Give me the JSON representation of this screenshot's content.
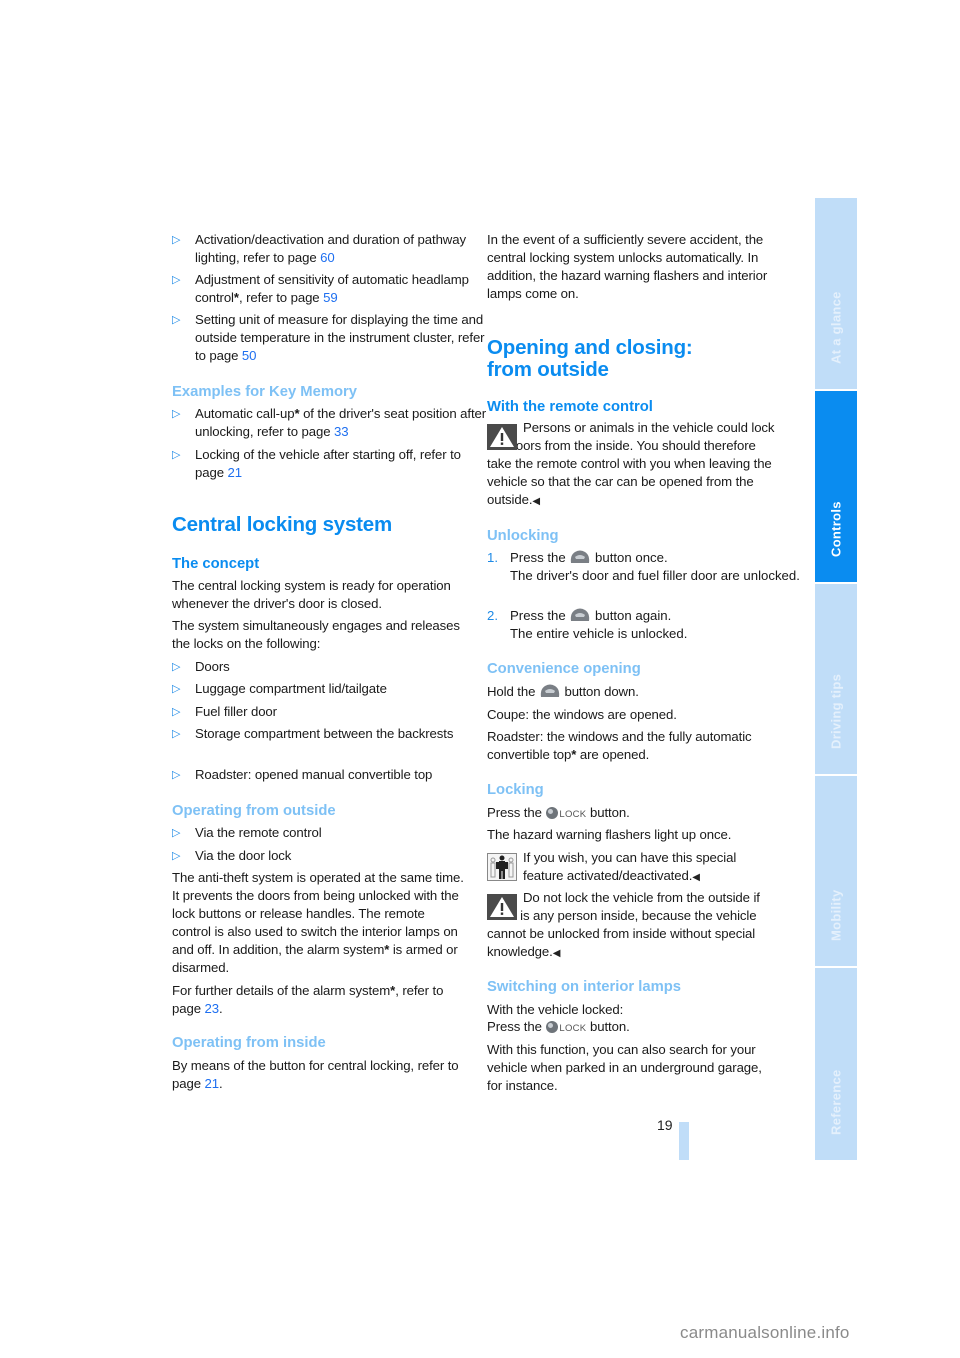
{
  "page_number": "19",
  "watermark": "carmanualsonline.info",
  "sidebar": {
    "tabs": [
      {
        "label": "At a glance",
        "active": false
      },
      {
        "label": "Controls",
        "active": true
      },
      {
        "label": "Driving tips",
        "active": false
      },
      {
        "label": "Mobility",
        "active": false
      },
      {
        "label": "Reference",
        "active": false
      }
    ]
  },
  "colors": {
    "heading": "#0a8cf0",
    "subheading_light": "#7ec1f5",
    "link": "#1e6ff0",
    "sidebar_active": "#0a8cf0",
    "sidebar_inactive": "#c0ddf8"
  },
  "left": {
    "top_bullets": [
      {
        "text": "Activation/deactivation and duration of pathway lighting, refer to page ",
        "page": "60"
      },
      {
        "text_a": "Adjustment of sensitivity of automatic headlamp control",
        "star": "*",
        "text_b": ", refer to page ",
        "page": "59"
      },
      {
        "text": "Setting unit of measure for displaying the time and outside temperature in the instrument cluster, refer to page ",
        "page": "50"
      }
    ],
    "key_memory": {
      "heading": "Examples for Key Memory",
      "bullets": [
        {
          "text_a": "Automatic call-up",
          "star": "*",
          "text_b": " of the driver's seat position after unlocking, refer to page ",
          "page": "33"
        },
        {
          "text": "Locking of the vehicle after starting off, refer to page ",
          "page": "21"
        }
      ]
    },
    "central_locking": {
      "heading": "Central locking system",
      "concept_heading": "The concept",
      "concept_p1": "The central locking system is ready for operation whenever the driver's door is closed.",
      "concept_p2": "The system simultaneously engages and releases the locks on the following:",
      "bullets": [
        "Doors",
        "Luggage compartment lid/tailgate",
        "Fuel filler door",
        "Storage compartment between the backrests",
        "Roadster: opened manual convertible top"
      ]
    },
    "operating_outside": {
      "heading": "Operating from outside",
      "bullets": [
        "Via the remote control",
        "Via the door lock"
      ],
      "p1_a": "The anti-theft system is operated at the same time. It prevents the doors from being unlocked with the lock buttons or release handles. The remote control is also used to switch the interior lamps on and off. In addition, the alarm system",
      "p1_star": "*",
      "p1_b": " is armed or disarmed.",
      "p2_a": "For further details of the alarm system",
      "p2_star": "*",
      "p2_b": ", refer to page ",
      "p2_page": "23",
      "p2_c": "."
    },
    "operating_inside": {
      "heading": "Operating from inside",
      "text": "By means of the button for central locking, refer to page ",
      "page": "21",
      "tail": "."
    }
  },
  "right": {
    "accident_p": "In the event of a sufficiently severe accident, the central locking system unlocks automatically. In addition, the hazard warning flashers and interior lamps come on.",
    "main_heading_line1": "Opening and closing:",
    "main_heading_line2": "from outside",
    "remote": {
      "heading": "With the remote control",
      "warning": "Persons or animals in the vehicle could lock the doors from the inside. You should therefore take the remote control with you when leaving the vehicle so that the car can be opened from the outside.",
      "end_mark": "◀"
    },
    "unlocking": {
      "heading": "Unlocking",
      "steps": [
        {
          "n": "1.",
          "pre": "Press the ",
          "post": " button once.",
          "result": "The driver's door and fuel filler door are unlocked."
        },
        {
          "n": "2.",
          "pre": "Press the ",
          "post": " button again.",
          "result": "The entire vehicle is unlocked."
        }
      ]
    },
    "convenience": {
      "heading": "Convenience opening",
      "p1_pre": "Hold the ",
      "p1_post": " button down.",
      "p2": "Coupe: the windows are opened.",
      "p3_a": "Roadster: the windows and the fully automatic convertible top",
      "p3_star": "*",
      "p3_b": " are opened."
    },
    "locking": {
      "heading": "Locking",
      "p1_pre": "Press the ",
      "lock_label": "LOCK",
      "p1_post": " button.",
      "p2": "The hazard warning flashers light up once.",
      "note": "If you wish, you can have this special feature activated/deactivated.",
      "warning": "Do not lock the vehicle from the outside if there is any person inside, because the vehicle cannot be unlocked from inside without special knowledge.",
      "end_mark": "◀"
    },
    "interior_lamps": {
      "heading": "Switching on interior lamps",
      "p1": "With the vehicle locked:",
      "p2_pre": "Press the ",
      "lock_label": "LOCK",
      "p2_post": " button.",
      "p3": "With this function, you can also search for your vehicle when parked in an underground garage, for instance."
    }
  }
}
